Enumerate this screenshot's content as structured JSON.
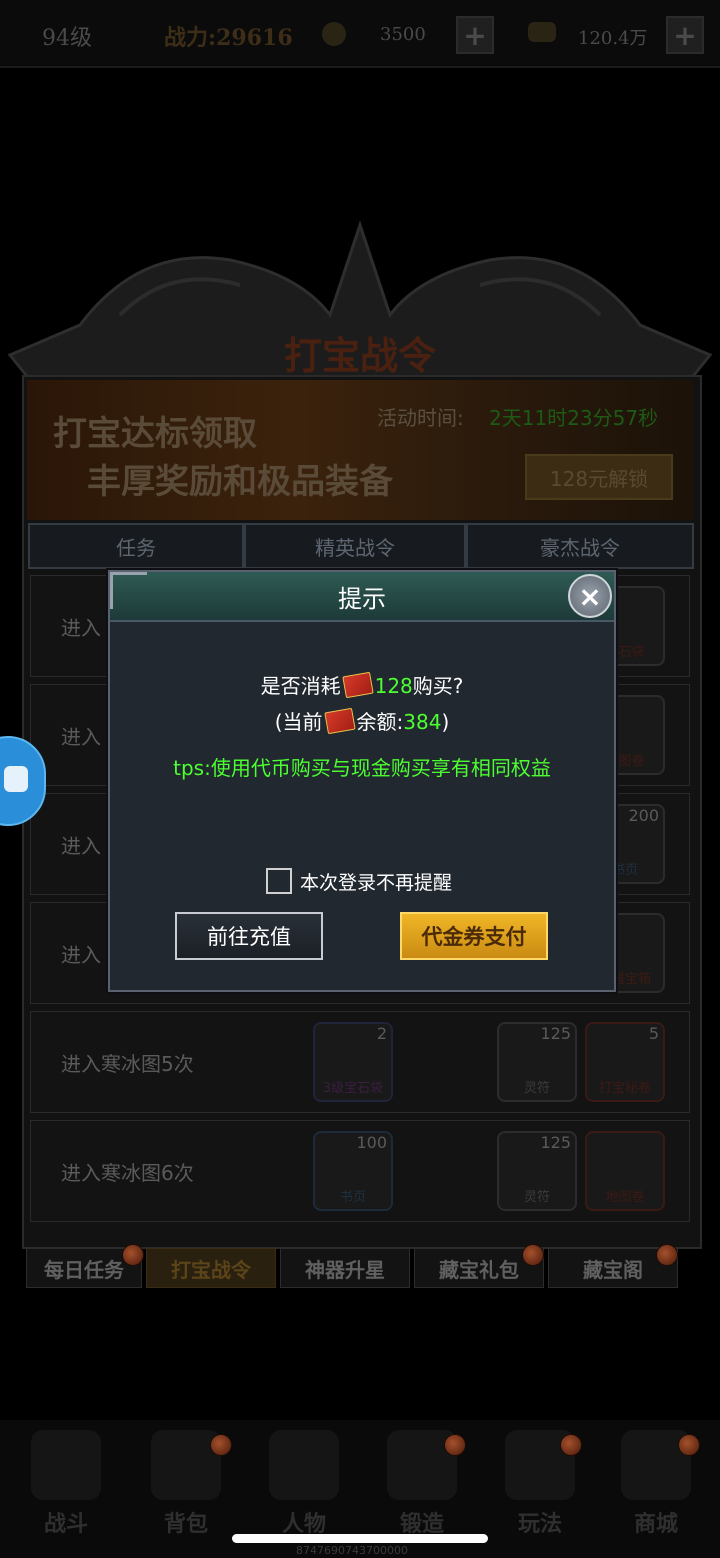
{
  "top_bar": {
    "level": "94级",
    "power": "战力:29616",
    "gold_value": "3500",
    "ingot_value": "120.4万",
    "plus_symbol": "+"
  },
  "panel": {
    "title": "打宝战令",
    "banner_line1": "打宝达标领取",
    "banner_line2": "丰厚奖励和极品装备",
    "activity_label": "活动时间:",
    "activity_time": "2天11时23分57秒",
    "unlock_button": "128元解锁",
    "tabs": [
      "任务",
      "精英战令",
      "豪杰战令"
    ]
  },
  "task_rows": [
    {
      "text": "进入",
      "items": [
        {
          "name": "星石袋",
          "count": ""
        }
      ]
    },
    {
      "text": "进入",
      "items": [
        {
          "name": "地图卷",
          "count": ""
        }
      ]
    },
    {
      "text": "进入",
      "items": [
        {
          "name": "书页",
          "count": "200"
        }
      ]
    },
    {
      "text": "进入",
      "items": [
        {
          "name": "神器宝箱",
          "count": ""
        }
      ]
    },
    {
      "text": "进入寒冰图5次",
      "items": [
        {
          "name": "3级宝石袋",
          "count": "2"
        },
        {
          "name": "灵符",
          "count": "125"
        },
        {
          "name": "打宝秘卷",
          "count": "5"
        }
      ]
    },
    {
      "text": "进入寒冰图6次",
      "items": [
        {
          "name": "书页",
          "count": "100"
        },
        {
          "name": "灵符",
          "count": "125"
        },
        {
          "name": "地图卷",
          "count": ""
        }
      ]
    }
  ],
  "bottom_tabs": [
    "每日任务",
    "打宝战令",
    "神器升星",
    "藏宝礼包",
    "藏宝阁"
  ],
  "nav": [
    "战斗",
    "背包",
    "人物",
    "锻造",
    "玩法",
    "商城"
  ],
  "footer_code": "8747690743700000",
  "dialog": {
    "title": "提示",
    "close": "×",
    "line1_prefix": "是否消耗",
    "line1_amount": "128",
    "line1_suffix": "购买?",
    "line2_prefix": "(当前",
    "line2_mid": "余额:",
    "line2_amount": "384",
    "line2_suffix": ")",
    "tip": "tps:使用代币购买与现金购买享有相同权益",
    "checkbox_label": "本次登录不再提醒",
    "recharge_button": "前往充值",
    "pay_button": "代金券支付",
    "voucher_icon_name": "voucher-icon"
  },
  "colors": {
    "highlight_green": "#4cff30",
    "pay_button": "#f0b626",
    "dialog_bg": "#222830"
  }
}
